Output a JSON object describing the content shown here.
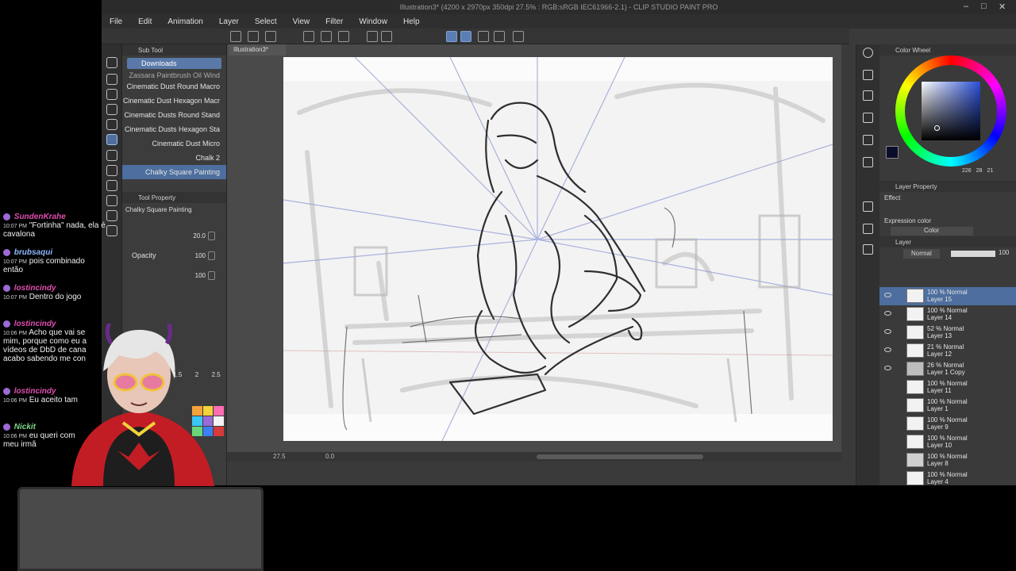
{
  "window": {
    "title": "Illustration3* (4200 x 2970px 350dpi 27.5% : RGB:sRGB IEC61966-2.1) - CLIP STUDIO PAINT PRO"
  },
  "menu": [
    "File",
    "Edit",
    "Animation",
    "Layer",
    "Select",
    "View",
    "Filter",
    "Window",
    "Help"
  ],
  "sub_tool": {
    "header": "Sub Tool",
    "active_tab": "Downloads",
    "brushes": [
      "Zassara Paintbrush Oil Wind",
      "Cinematic Dust Round Macro",
      "Cinematic Dust Hexagon Macr",
      "Cinematic Dusts Round Stand",
      "Cinematic Dusts Hexagon Sta",
      "Cinematic Dust Micro",
      "Chalk 2",
      "Chalky Square Painting"
    ],
    "selected_index": 7
  },
  "tool_property": {
    "header": "Tool Property",
    "brush_name": "Chalky Square Painting",
    "size_value": "20.0",
    "opacity_label": "Opacity",
    "opacity_value": "100",
    "density_value": "100",
    "stabilize_values": [
      "1.5",
      "2",
      "2.5"
    ]
  },
  "canvas": {
    "doc_tab": "Illustration3*",
    "zoom": "27.5",
    "angle": "0.0"
  },
  "color_wheel": {
    "header": "Color Wheel",
    "main_color": "#0a0d2a",
    "values": [
      "226",
      "28",
      "21"
    ]
  },
  "layer_property": {
    "header": "Layer Property",
    "effect_label": "Effect",
    "expression_label": "Expression color",
    "expression_value": "Color"
  },
  "layer_panel": {
    "header": "Layer",
    "blend_mode": "Normal",
    "opacity": "100",
    "layers": [
      {
        "mode": "100 % Normal",
        "name": "Layer 15",
        "visible": true
      },
      {
        "mode": "100 % Normal",
        "name": "Layer 14",
        "visible": true
      },
      {
        "mode": "52 % Normal",
        "name": "Layer 13",
        "visible": true
      },
      {
        "mode": "21 % Normal",
        "name": "Layer 12",
        "visible": true
      },
      {
        "mode": "26 % Normal",
        "name": "Layer 1 Copy",
        "visible": true
      },
      {
        "mode": "100 % Normal",
        "name": "Layer 11",
        "visible": false
      },
      {
        "mode": "100 % Normal",
        "name": "Layer 1",
        "visible": false
      },
      {
        "mode": "100 % Normal",
        "name": "Layer 9",
        "visible": false
      },
      {
        "mode": "100 % Normal",
        "name": "Layer 10",
        "visible": false
      },
      {
        "mode": "100 % Normal",
        "name": "Layer 8",
        "visible": false
      },
      {
        "mode": "100 % Normal",
        "name": "Layer 4",
        "visible": false
      }
    ],
    "selected_index": 0
  },
  "chat": [
    {
      "user": "SundenKrahe",
      "color": "#e04fb0",
      "time": "10:07 PM",
      "text": "\"Fortinha\" nada, ela é cavalona"
    },
    {
      "user": "brubsaqui",
      "color": "#8fb8ff",
      "time": "10:07 PM",
      "text": "pois combinado então"
    },
    {
      "user": "lostincindy",
      "color": "#e04fb0",
      "time": "10:07 PM",
      "text": "Dentro do jogo"
    },
    {
      "user": "lostincindy",
      "color": "#e04fb0",
      "time": "10:06 PM",
      "text": "Acho que vai se mim, porque como eu a vídeos de DbD de cana acabo sabendo me con"
    },
    {
      "user": "lostincindy",
      "color": "#e04fb0",
      "time": "10:06 PM",
      "text": "Eu aceito tam"
    },
    {
      "user": "Nickit",
      "color": "#7fd68a",
      "time": "10:06 PM",
      "text": "eu queri com meu irmã"
    }
  ]
}
